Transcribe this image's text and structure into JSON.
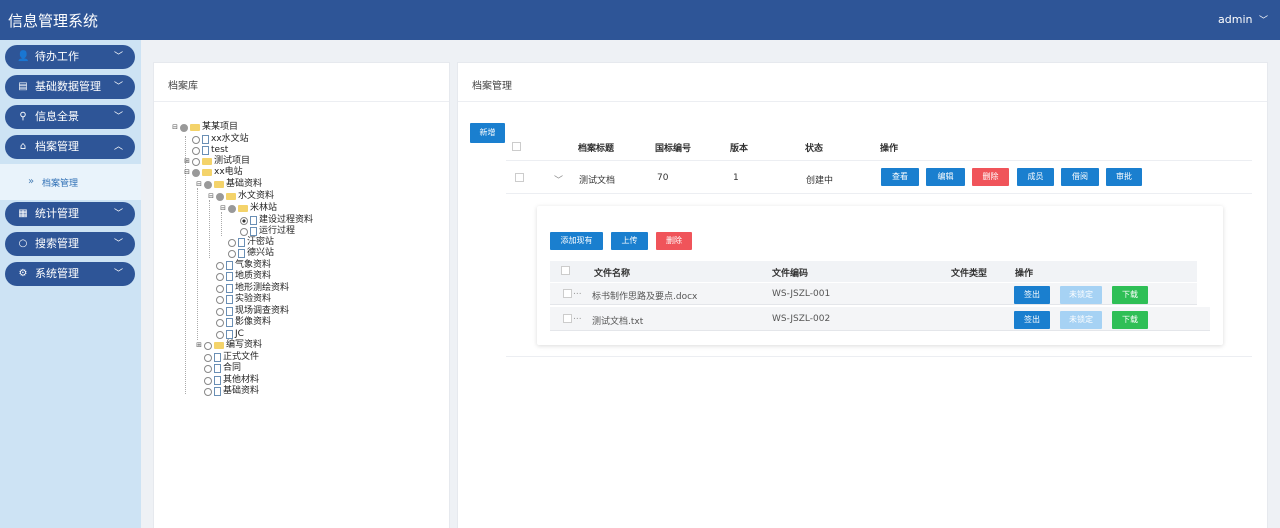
{
  "app": {
    "title": "信息管理系统",
    "user": "admin",
    "user_chevron": "﹀"
  },
  "sidebar": {
    "items": [
      {
        "label": "待办工作",
        "icon": "user-icon",
        "glyph": "👤"
      },
      {
        "label": "基础数据管理",
        "icon": "clipboard-icon",
        "glyph": "▤"
      },
      {
        "label": "信息全景",
        "icon": "location-icon",
        "glyph": "⚲"
      },
      {
        "label": "档案管理",
        "icon": "archive-icon",
        "glyph": "⌂"
      },
      {
        "label": "统计管理",
        "icon": "stats-icon",
        "glyph": "▦"
      },
      {
        "label": "搜索管理",
        "icon": "search-icon",
        "glyph": "○"
      },
      {
        "label": "系统管理",
        "icon": "gear-icon",
        "glyph": "⚙"
      }
    ],
    "chevron_down": "﹀",
    "chevron_up": "︿",
    "sub": {
      "icon": "»",
      "label": "档案管理"
    }
  },
  "left_panel": {
    "title": "档案库"
  },
  "tree": [
    {
      "label": "某某项目"
    },
    {
      "label": "xx水文站"
    },
    {
      "label": "test"
    },
    {
      "label": "测试项目"
    },
    {
      "label": "xx电站"
    },
    {
      "label": "基础资料"
    },
    {
      "label": "水文资料"
    },
    {
      "label": "米林站"
    },
    {
      "label": "建设过程资料"
    },
    {
      "label": "运行过程"
    },
    {
      "label": "汗密站"
    },
    {
      "label": "德兴站"
    },
    {
      "label": "气象资料"
    },
    {
      "label": "地质资料"
    },
    {
      "label": "地形测绘资料"
    },
    {
      "label": "实验资料"
    },
    {
      "label": "现场调查资料"
    },
    {
      "label": "影像资料"
    },
    {
      "label": "JC"
    },
    {
      "label": "编写资料"
    },
    {
      "label": "正式文件"
    },
    {
      "label": "合同"
    },
    {
      "label": "其他材料"
    },
    {
      "label": "基础资料"
    }
  ],
  "right_panel": {
    "title": "档案管理",
    "add_button": "新增",
    "columns": {
      "title": "档案标题",
      "code": "国标编号",
      "version": "版本",
      "status": "状态",
      "ops": "操作"
    },
    "row": {
      "expand": "﹀",
      "title": "测试文档",
      "code": "70",
      "version": "1",
      "status": "创建中",
      "actions": {
        "view": "查看",
        "edit": "编辑",
        "delete": "删除",
        "members": "成员",
        "borrow": "借阅",
        "approve": "审批"
      }
    },
    "files": {
      "buttons": {
        "add_existing": "添加现有",
        "upload": "上传",
        "delete": "删除"
      },
      "columns": {
        "name": "文件名称",
        "code": "文件编码",
        "type": "文件类型",
        "ops": "操作"
      },
      "rows": [
        {
          "dots": "...",
          "name": "标书制作思路及要点.docx",
          "code": "WS-JSZL-001",
          "type": "",
          "checkout": "签出",
          "unlock": "未锁定",
          "download": "下载"
        },
        {
          "dots": "...",
          "name": "测试文档.txt",
          "code": "WS-JSZL-002",
          "type": "",
          "checkout": "签出",
          "unlock": "未锁定",
          "download": "下载"
        }
      ]
    }
  }
}
